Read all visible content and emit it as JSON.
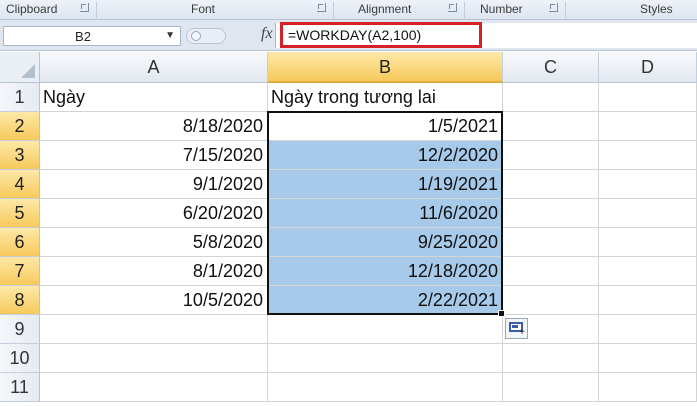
{
  "ribbon": {
    "groups": [
      {
        "label": "Clipboard"
      },
      {
        "label": "Font"
      },
      {
        "label": "Alignment"
      },
      {
        "label": "Number"
      },
      {
        "label": "Styles"
      }
    ]
  },
  "formula_bar": {
    "name_box": "B2",
    "fx_label": "fx",
    "formula": "=WORKDAY(A2,100)"
  },
  "sheet": {
    "columns": [
      "A",
      "B",
      "C",
      "D"
    ],
    "selected_column": "B",
    "rows": [
      "1",
      "2",
      "3",
      "4",
      "5",
      "6",
      "7",
      "8",
      "9",
      "10",
      "11"
    ],
    "selected_rows": [
      "2",
      "3",
      "4",
      "5",
      "6",
      "7",
      "8"
    ],
    "header_row": {
      "a": "Ngày",
      "b": "Ngày trong tương lai"
    },
    "data": [
      {
        "a": "8/18/2020",
        "b": "1/5/2021"
      },
      {
        "a": "7/15/2020",
        "b": "12/2/2020"
      },
      {
        "a": "9/1/2020",
        "b": "1/19/2021"
      },
      {
        "a": "6/20/2020",
        "b": "11/6/2020"
      },
      {
        "a": "5/8/2020",
        "b": "9/25/2020"
      },
      {
        "a": "8/1/2020",
        "b": "12/18/2020"
      },
      {
        "a": "10/5/2020",
        "b": "2/22/2021"
      }
    ]
  },
  "colors": {
    "selection_fill": "#a7caeb",
    "highlight_border": "#d62028",
    "selected_header": "#f6c95c"
  }
}
